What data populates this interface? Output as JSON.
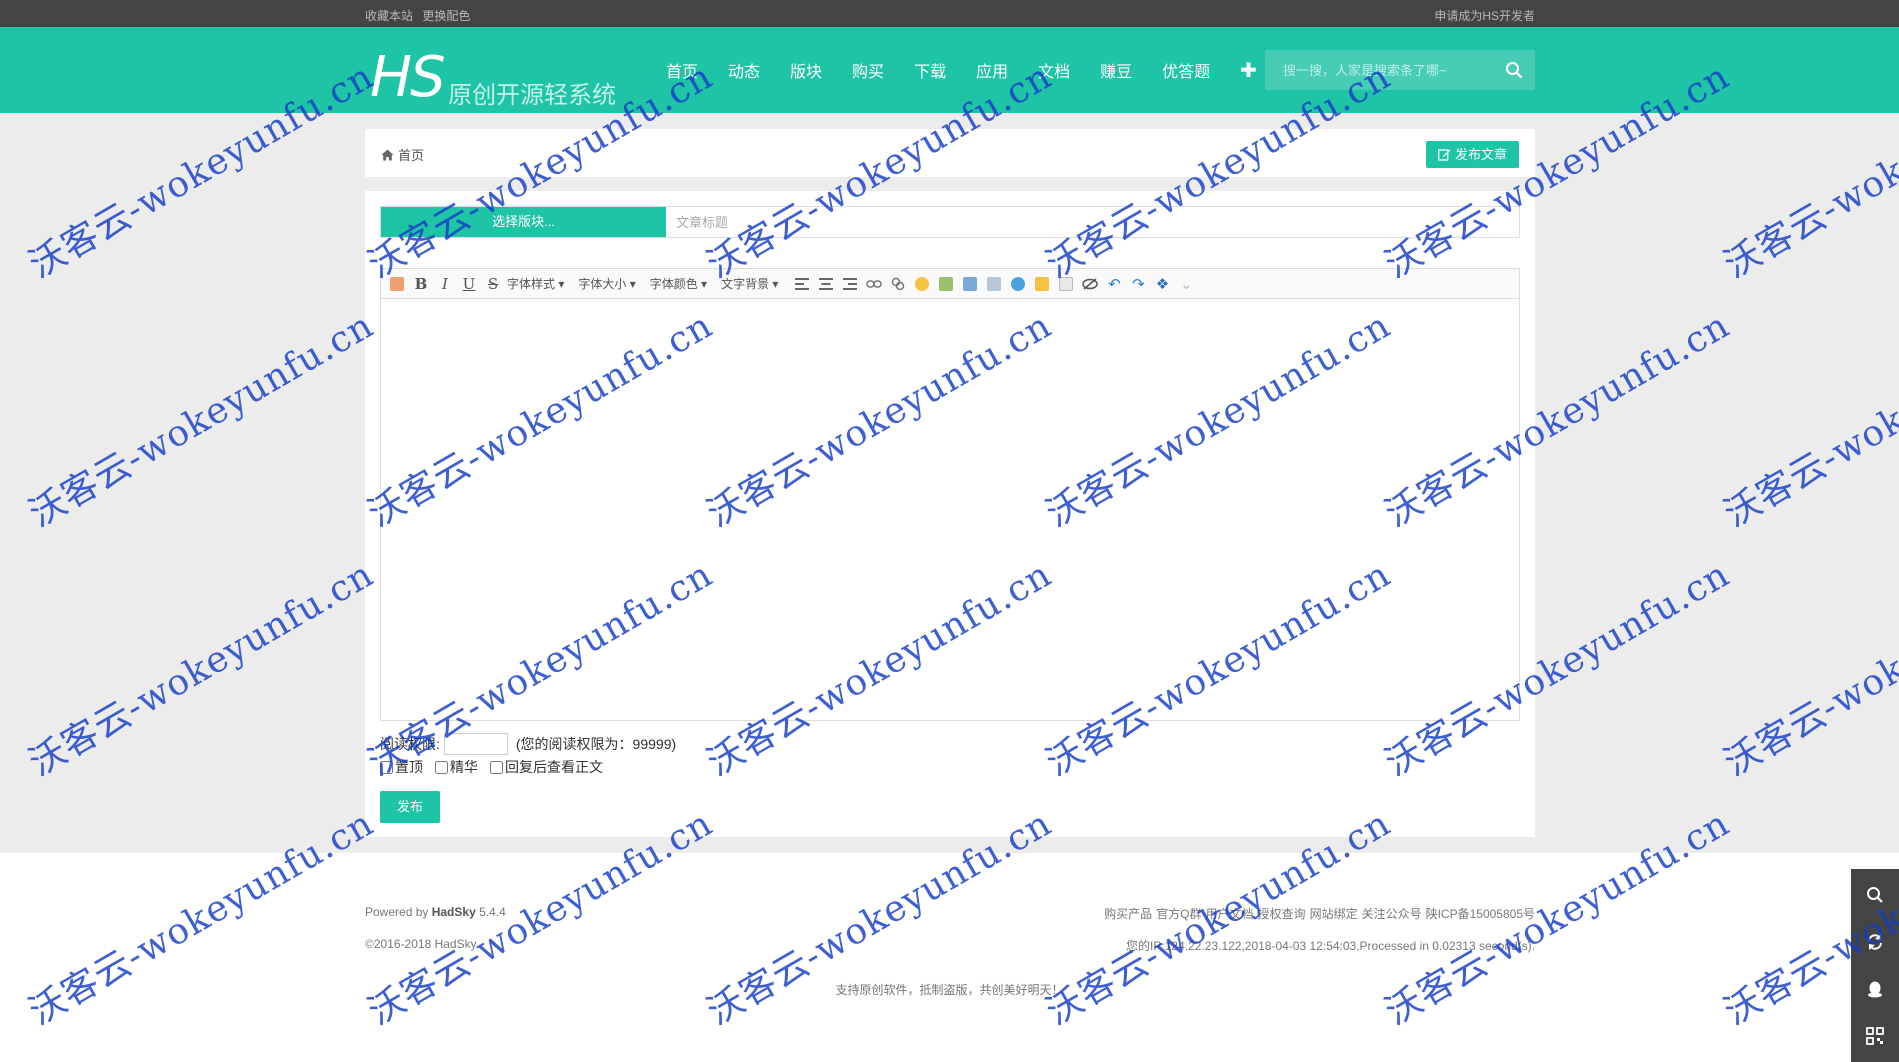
{
  "topbar": {
    "bookmark": "收藏本站",
    "color_switch": "更换配色",
    "apply_dev": "申请成为HS开发者"
  },
  "header": {
    "logo": "HS",
    "slogan": "原创开源轻系统",
    "nav": [
      "首页",
      "动态",
      "版块",
      "购买",
      "下载",
      "应用",
      "文档",
      "赚豆",
      "优答题"
    ],
    "plus": "✚",
    "search_placeholder": "搜一搜，人家是搜索条了哪~",
    "accent_color": "#1fc3a6"
  },
  "breadcrumb": {
    "home": "首页",
    "publish_article": "发布文章"
  },
  "post_form": {
    "forum_select": "选择版块...",
    "title_placeholder": "文章标题",
    "toolbar": {
      "icons": [
        "source-icon",
        "bold-icon",
        "italic-icon",
        "underline-icon",
        "strikethrough-icon"
      ],
      "font_style": "字体样式 ▾",
      "font_size": "字体大小 ▾",
      "font_color": "字体颜色 ▾",
      "bg_color": "文字背景 ▾"
    },
    "permission_label": "阅读权限:",
    "permission_value": "",
    "permission_note": "(您的阅读权限为：99999)",
    "sticky": "置顶",
    "essence": "精华",
    "reply_view": "回复后查看正文",
    "publish": "发布"
  },
  "footer": {
    "powered_prefix": "Powered by",
    "powered_brand": "HadSky",
    "powered_version": "5.4.4",
    "copyright": "©2016-2018 HadSky",
    "links": [
      "购买产品",
      "官方Q群",
      "用户文档",
      "授权查询",
      "网站绑定",
      "关注公众号",
      "陕ICP备15005805号"
    ],
    "info": "您的IP:124.22.23.122,2018-04-03 12:54:03,Processed in 0.02313 second(s).",
    "support": "支持原创软件，抵制盗版，共创美好明天！"
  },
  "watermark": "沃客云-wokeyunfu.cn"
}
